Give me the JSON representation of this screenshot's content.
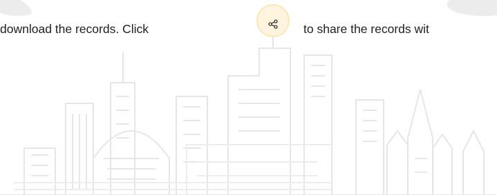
{
  "instruction": {
    "text_before": "download the records. Click",
    "text_after": "to share the records wit"
  },
  "icons": {
    "share": "share-icon"
  },
  "colors": {
    "skyline": "#e6e6e6",
    "share_highlight": "#fff4dd",
    "text": "#1f1f1f"
  }
}
